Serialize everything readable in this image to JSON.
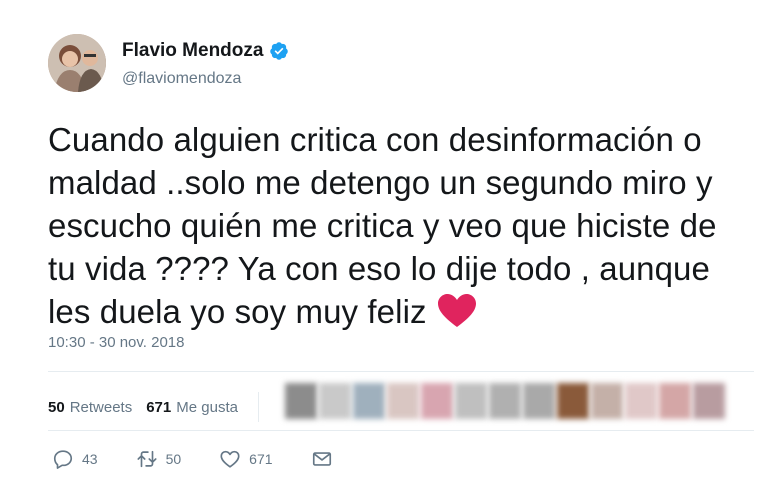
{
  "author": {
    "name": "Flavio Mendoza",
    "handle": "@flaviomendoza",
    "verified": true
  },
  "tweet": {
    "lines": [
      "Cuando alguien critica con desinformación o",
      "maldad ..solo me detengo un segundo miro y",
      "escucho quién me critica y veo que hiciste de",
      "tu vida ???? Ya con eso lo dije todo , aunque",
      "les duela yo soy muy feliz"
    ],
    "emoji": "red-heart",
    "timestamp": "10:30 - 30 nov. 2018"
  },
  "stats": {
    "retweets_count": "50",
    "retweets_label": "Retweets",
    "likes_count": "671",
    "likes_label": "Me gusta"
  },
  "liker_avatar_colors": [
    "#8c8c8c",
    "#c9c9c9",
    "#9fb0bd",
    "#d9c6c2",
    "#d8a5b0",
    "#bfbfbf",
    "#b0b0b0",
    "#a9a9a9",
    "#8a5a3a",
    "#c4b0a8",
    "#e0c8c8",
    "#d4a6a6",
    "#b89ca0"
  ],
  "actions": {
    "reply_count": "43",
    "retweet_count": "50",
    "like_count": "671"
  },
  "colors": {
    "verified_blue": "#1da1f2",
    "muted_text": "#657786",
    "heart_red": "#e0245e"
  }
}
